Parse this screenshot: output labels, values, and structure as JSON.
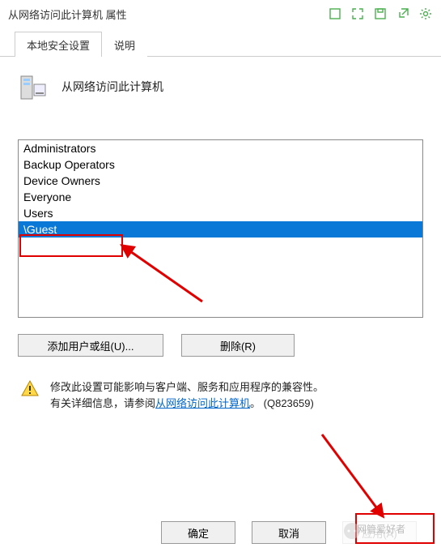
{
  "window": {
    "title": "从网络访问此计算机 属性"
  },
  "tabs": {
    "active": "本地安全设置",
    "other": "说明"
  },
  "policy": {
    "heading": "从网络访问此计算机"
  },
  "list": {
    "items": [
      {
        "label": "Administrators",
        "selected": false
      },
      {
        "label": "Backup Operators",
        "selected": false
      },
      {
        "label": "Device Owners",
        "selected": false
      },
      {
        "label": "Everyone",
        "selected": false
      },
      {
        "label": "Users",
        "selected": false
      },
      {
        "label": "\\Guest",
        "selected": true
      }
    ]
  },
  "buttons": {
    "add": "添加用户或组(U)...",
    "remove": "删除(R)",
    "ok": "确定",
    "cancel": "取消",
    "apply": "应用(A)"
  },
  "info": {
    "line1": "修改此设置可能影响与客户端、服务和应用程序的兼容性。",
    "line2a": "有关详细信息，请参阅",
    "link": "从网络访问此计算机",
    "line2b": "。  (Q823659)"
  },
  "watermark": "网管爱好者",
  "icons": {
    "server": "server-icon",
    "warning": "warning-icon",
    "maximize": "maximize-icon",
    "fullscreen": "fullscreen-icon",
    "save": "save-icon",
    "share": "share-icon",
    "settings": "gear-icon"
  }
}
